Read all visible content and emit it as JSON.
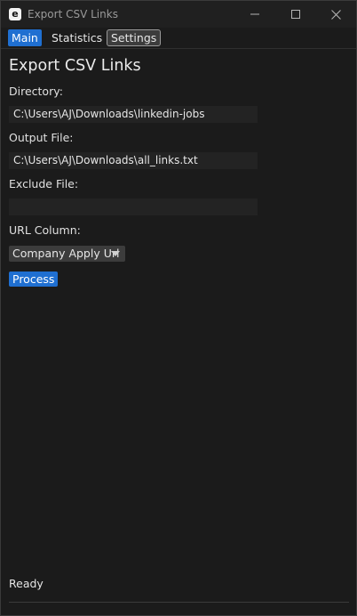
{
  "window": {
    "icon_letter": "e",
    "title": "Export CSV Links"
  },
  "tabs": [
    {
      "label": "Main",
      "state": "active"
    },
    {
      "label": "Statistics",
      "state": "normal"
    },
    {
      "label": "Settings",
      "state": "hovered"
    }
  ],
  "main": {
    "heading": "Export CSV Links",
    "directory": {
      "label": "Directory:",
      "value": "C:\\Users\\AJ\\Downloads\\linkedin-jobs"
    },
    "output_file": {
      "label": "Output File:",
      "value": "C:\\Users\\AJ\\Downloads\\all_links.txt"
    },
    "exclude_file": {
      "label": "Exclude File:",
      "value": ""
    },
    "url_column": {
      "label": "URL Column:",
      "selected": "Company Apply Url"
    },
    "process_label": "Process"
  },
  "status": {
    "text": "Ready"
  },
  "colors": {
    "accent": "#1f6fd1",
    "background": "#1b1b1b",
    "titlebar": "#202020",
    "field": "#232323"
  },
  "icons": [
    "minimize-icon",
    "maximize-icon",
    "close-icon",
    "chevron-down-icon"
  ]
}
